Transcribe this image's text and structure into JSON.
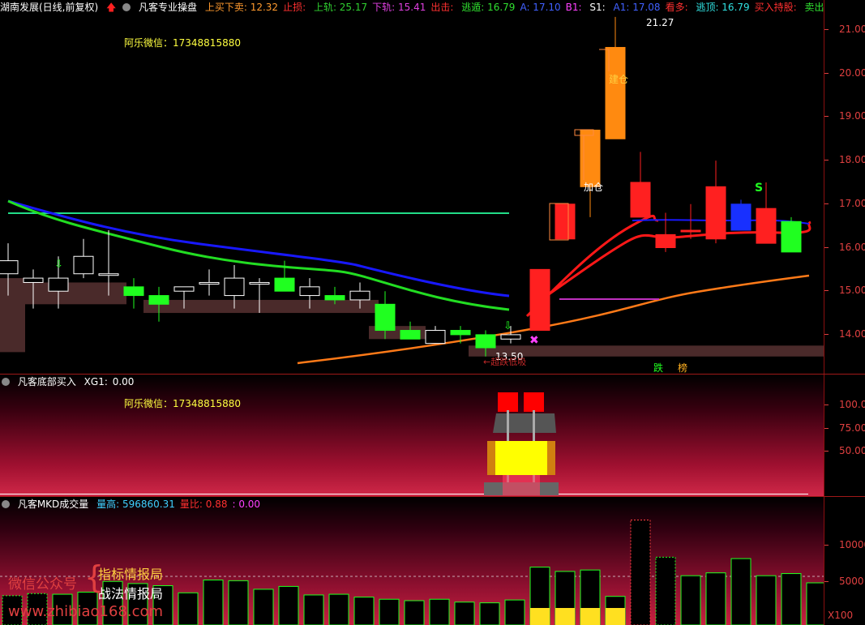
{
  "main": {
    "title": "湖南发展(日线,前复权)",
    "indicator": "凡客专业操盘",
    "header_items": [
      {
        "label": "上买下卖:",
        "value": "12.32",
        "color": "#ff9a2e"
      },
      {
        "label": "止损:",
        "value": "",
        "color": "#ff3030"
      },
      {
        "label": "上轨:",
        "value": "25.17",
        "color": "#30d030"
      },
      {
        "label": "下轨:",
        "value": "15.41",
        "color": "#e040e0"
      },
      {
        "label": "出击:",
        "value": "",
        "color": "#ff3030"
      },
      {
        "label": "逃遁:",
        "value": "16.79",
        "color": "#30e030"
      },
      {
        "label": "A:",
        "value": "17.10",
        "color": "#4060ff"
      },
      {
        "label": "B1:",
        "value": "",
        "color": "#ff40ff"
      },
      {
        "label": "S1:",
        "value": "",
        "color": "#ffffff"
      },
      {
        "label": "A1:",
        "value": "17.08",
        "color": "#4060ff"
      },
      {
        "label": "看多:",
        "value": "",
        "color": "#ff3030"
      },
      {
        "label": "逃顶:",
        "value": "16.79",
        "color": "#30e0e0"
      },
      {
        "label": "买入持股:",
        "value": "",
        "color": "#ff3030"
      },
      {
        "label": "卖出◇",
        "value": "",
        "color": "#30e030"
      }
    ],
    "watermark": "阿乐微信：17348815880",
    "labels": {
      "jiancang": "建仓",
      "jiacang": "加仓",
      "s_mark": "S",
      "high_price": "21.27",
      "low_price": "13.50",
      "low_note": "←超跌低吸",
      "die": "跌",
      "bang": "榜"
    },
    "y_ticks": [
      "21.00",
      "20.00",
      "19.00",
      "18.00",
      "17.00",
      "16.00",
      "15.00",
      "14.00"
    ]
  },
  "bottom_buy": {
    "title": "凡客底部买入",
    "xg_label": "XG1:",
    "xg_value": "0.00",
    "watermark": "阿乐微信：17348815880",
    "y_ticks": [
      "100.0",
      "75.00",
      "50.00"
    ]
  },
  "volume": {
    "title": "凡客MKD成交量",
    "items": [
      {
        "label": "量高:",
        "value": "596860.31",
        "color": "#40d0ff"
      },
      {
        "label": "量比:",
        "value": "0.88",
        "color": "#ff3030"
      },
      {
        "label": ":",
        "value": "0.00",
        "color": "#ff40ff"
      }
    ],
    "y_ticks": [
      "10000",
      "5000"
    ],
    "unit": "X100",
    "overlay": {
      "wechat": "微信公众号",
      "line1": "指标情报局",
      "line2": "战法情报局",
      "site": "www.zhibiao168.com"
    }
  },
  "colors": {
    "up": "#ff2020",
    "down": "#20ff20",
    "ma_blue": "#1818ff",
    "ma_green": "#22dd22",
    "ma_red": "#ff1818",
    "ma_orange": "#ff7a18",
    "axis": "#e04040"
  },
  "chart_data": {
    "type": "candlestick",
    "y_range": [
      13.5,
      21.5
    ],
    "candles": [
      {
        "o": 15.4,
        "h": 16.1,
        "l": 14.9,
        "c": 15.7
      },
      {
        "o": 15.2,
        "h": 15.5,
        "l": 14.6,
        "c": 15.3
      },
      {
        "o": 15.0,
        "h": 15.8,
        "l": 14.6,
        "c": 15.3
      },
      {
        "o": 15.4,
        "h": 16.2,
        "l": 15.3,
        "c": 15.8
      },
      {
        "o": 15.4,
        "h": 16.4,
        "l": 14.9,
        "c": 15.4
      },
      {
        "o": 15.1,
        "h": 15.3,
        "l": 14.6,
        "c": 14.9
      },
      {
        "o": 14.9,
        "h": 15.1,
        "l": 14.3,
        "c": 14.7
      },
      {
        "o": 15.0,
        "h": 15.1,
        "l": 14.6,
        "c": 15.1
      },
      {
        "o": 15.2,
        "h": 15.5,
        "l": 14.9,
        "c": 15.2
      },
      {
        "o": 14.9,
        "h": 15.6,
        "l": 14.6,
        "c": 15.3
      },
      {
        "o": 15.2,
        "h": 15.3,
        "l": 14.5,
        "c": 15.2
      },
      {
        "o": 15.3,
        "h": 15.7,
        "l": 15.0,
        "c": 15.0
      },
      {
        "o": 14.9,
        "h": 15.3,
        "l": 14.6,
        "c": 15.1
      },
      {
        "o": 14.9,
        "h": 15.1,
        "l": 14.7,
        "c": 14.8
      },
      {
        "o": 14.8,
        "h": 15.2,
        "l": 14.6,
        "c": 15.0
      },
      {
        "o": 14.7,
        "h": 15.0,
        "l": 13.9,
        "c": 14.1
      },
      {
        "o": 14.1,
        "h": 14.3,
        "l": 13.9,
        "c": 13.9
      },
      {
        "o": 13.8,
        "h": 14.2,
        "l": 13.8,
        "c": 14.1
      },
      {
        "o": 14.1,
        "h": 14.2,
        "l": 13.8,
        "c": 14.0
      },
      {
        "o": 14.0,
        "h": 14.1,
        "l": 13.5,
        "c": 13.7
      },
      {
        "o": 13.9,
        "h": 14.2,
        "l": 13.8,
        "c": 14.0
      },
      {
        "o": 14.1,
        "h": 15.5,
        "l": 14.1,
        "c": 15.5
      },
      {
        "o": 16.2,
        "h": 17.0,
        "l": 16.2,
        "c": 17.0
      },
      {
        "o": 17.4,
        "h": 18.7,
        "l": 16.7,
        "c": 18.7
      },
      {
        "o": 20.6,
        "h": 21.3,
        "l": 18.5,
        "c": 18.5
      },
      {
        "o": 16.7,
        "h": 18.2,
        "l": 16.7,
        "c": 17.5
      },
      {
        "o": 16.0,
        "h": 16.8,
        "l": 15.9,
        "c": 16.3
      },
      {
        "o": 16.4,
        "h": 17.0,
        "l": 16.2,
        "c": 16.4
      },
      {
        "o": 16.2,
        "h": 18.0,
        "l": 16.1,
        "c": 17.4
      },
      {
        "o": 17.0,
        "h": 17.1,
        "l": 16.4,
        "c": 16.4
      },
      {
        "o": 16.1,
        "h": 17.5,
        "l": 16.1,
        "c": 16.9
      },
      {
        "o": 16.6,
        "h": 16.7,
        "l": 15.9,
        "c": 15.9
      }
    ],
    "volumes": [
      3200,
      3500,
      3400,
      3700,
      5200,
      4900,
      4600,
      3600,
      5400,
      5300,
      4100,
      4500,
      3300,
      3400,
      3000,
      2700,
      2500,
      2700,
      2300,
      2200,
      2600,
      7200,
      6600,
      6800,
      3100,
      13800,
      8600,
      6000,
      6400,
      8400,
      6000,
      6300,
      5000
    ]
  }
}
